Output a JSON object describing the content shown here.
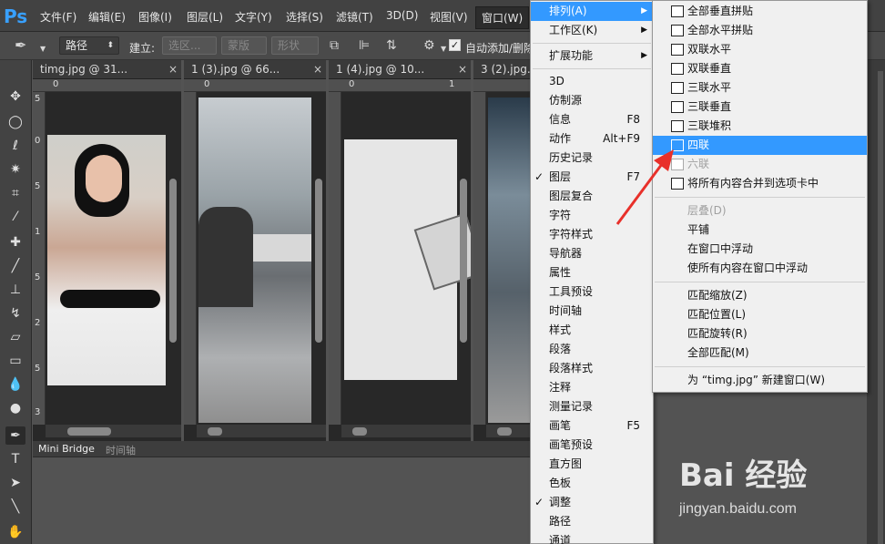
{
  "app": {
    "logo": "Ps"
  },
  "menubar": {
    "items": [
      "文件(F)",
      "编辑(E)",
      "图像(I)",
      "图层(L)",
      "文字(Y)",
      "选择(S)",
      "滤镜(T)",
      "3D(D)",
      "视图(V)",
      "窗口(W)"
    ],
    "active": "窗口(W)"
  },
  "options": {
    "mode_value": "路径",
    "make_label": "建立:",
    "selection_button": "选区...",
    "mask_button": "蒙版",
    "shape_button": "形状",
    "auto_add_label": "自动添加/删除"
  },
  "documents": [
    {
      "tab": "timg.jpg @ 31...",
      "close": "×"
    },
    {
      "tab": "1 (3).jpg @ 66...",
      "close": "×"
    },
    {
      "tab": "1 (4).jpg @ 10...",
      "close": "×"
    },
    {
      "tab": "3 (2).jpg...",
      "close": ""
    }
  ],
  "rulers": {
    "h_zero": "0",
    "h_one": "1",
    "v_labels": [
      "5",
      "0",
      "5",
      "1",
      "5",
      "2",
      "5",
      "3"
    ]
  },
  "bottom_panel": {
    "tabs": [
      "Mini Bridge",
      "时间轴"
    ]
  },
  "window_menu": {
    "items": [
      {
        "label": "排列(A)",
        "submenu": true,
        "highlighted": true
      },
      {
        "label": "工作区(K)",
        "submenu": true
      },
      {
        "sep": true
      },
      {
        "label": "扩展功能",
        "submenu": true
      },
      {
        "sep": true
      },
      {
        "label": "3D"
      },
      {
        "label": "仿制源"
      },
      {
        "label": "信息",
        "shortcut": "F8"
      },
      {
        "label": "动作",
        "shortcut": "Alt+F9"
      },
      {
        "label": "历史记录"
      },
      {
        "label": "图层",
        "shortcut": "F7",
        "checked": true
      },
      {
        "label": "图层复合"
      },
      {
        "label": "字符"
      },
      {
        "label": "字符样式"
      },
      {
        "label": "导航器"
      },
      {
        "label": "属性"
      },
      {
        "label": "工具预设"
      },
      {
        "label": "时间轴"
      },
      {
        "label": "样式"
      },
      {
        "label": "段落"
      },
      {
        "label": "段落样式"
      },
      {
        "label": "注释"
      },
      {
        "label": "测量记录"
      },
      {
        "label": "画笔",
        "shortcut": "F5"
      },
      {
        "label": "画笔预设"
      },
      {
        "label": "直方图"
      },
      {
        "label": "色板"
      },
      {
        "label": "调整",
        "checked": true
      },
      {
        "label": "路径"
      },
      {
        "label": "通道"
      }
    ]
  },
  "arrange_submenu": {
    "items": [
      {
        "label": "全部垂直拼贴",
        "icon": "tile-vertical-icon"
      },
      {
        "label": "全部水平拼贴",
        "icon": "tile-horizontal-icon"
      },
      {
        "label": "双联水平",
        "icon": "two-up-horizontal-icon"
      },
      {
        "label": "双联垂直",
        "icon": "two-up-vertical-icon"
      },
      {
        "label": "三联水平",
        "icon": "three-up-horizontal-icon"
      },
      {
        "label": "三联垂直",
        "icon": "three-up-vertical-icon"
      },
      {
        "label": "三联堆积",
        "icon": "three-up-stacked-icon"
      },
      {
        "label": "四联",
        "icon": "four-up-icon",
        "highlighted": true
      },
      {
        "label": "六联",
        "icon": "six-up-icon",
        "disabled": true
      },
      {
        "label": "将所有内容合并到选项卡中",
        "icon": "consolidate-tabs-icon"
      },
      {
        "sep": true
      },
      {
        "label": "层叠(D)",
        "disabled": true
      },
      {
        "label": "平铺"
      },
      {
        "label": "在窗口中浮动"
      },
      {
        "label": "使所有内容在窗口中浮动"
      },
      {
        "sep": true
      },
      {
        "label": "匹配缩放(Z)"
      },
      {
        "label": "匹配位置(L)"
      },
      {
        "label": "匹配旋转(R)"
      },
      {
        "label": "全部匹配(M)"
      },
      {
        "sep": true
      },
      {
        "label": "为 “timg.jpg” 新建窗口(W)"
      }
    ]
  },
  "watermark": {
    "brand": "Bai 经验",
    "url": "jingyan.baidu.com"
  },
  "colors": {
    "highlight": "#3399ff",
    "arrow": "#e8302a",
    "ps_blue": "#38a0ff"
  }
}
